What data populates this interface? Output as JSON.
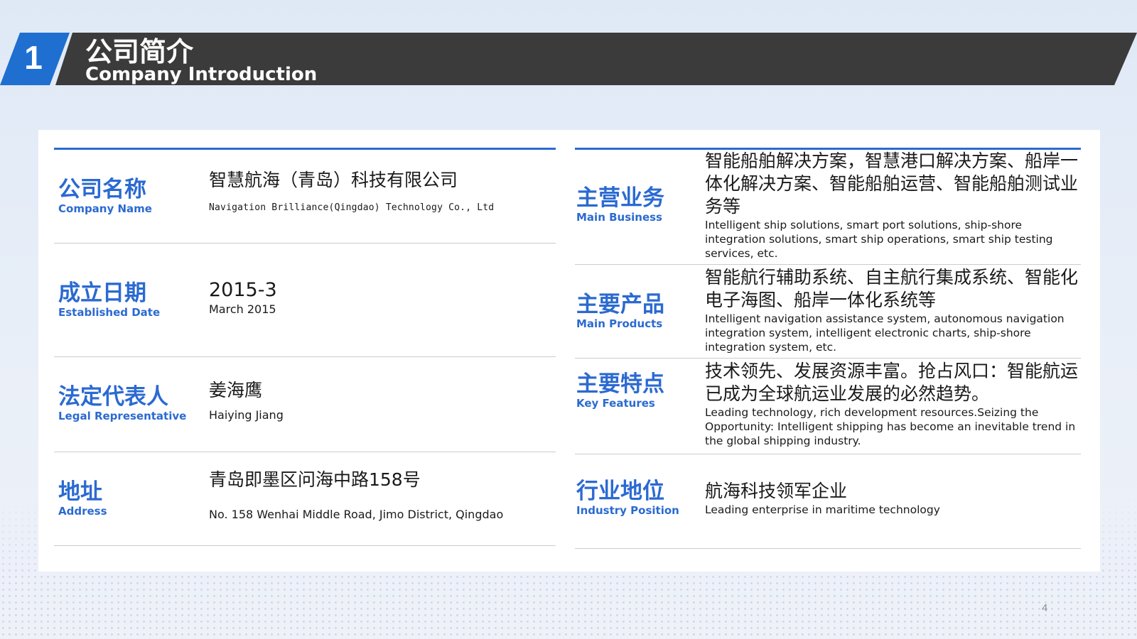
{
  "header": {
    "number": "1",
    "title_cn": "公司简介",
    "title_en": "Company Introduction"
  },
  "left_rows": [
    {
      "label_cn": "公司名称",
      "label_en": "Company Name",
      "value_cn": "智慧航海（青岛）科技有限公司",
      "value_en": "Navigation Brilliance(Qingdao) Technology Co., Ltd"
    },
    {
      "label_cn": "成立日期",
      "label_en": "Established Date",
      "value_cn": "2015-3",
      "value_en": "March 2015"
    },
    {
      "label_cn": "法定代表人",
      "label_en": "Legal Representative",
      "value_cn": "姜海鹰",
      "value_en": "Haiying Jiang"
    },
    {
      "label_cn": "地址",
      "label_en": "Address",
      "value_cn": "青岛即墨区问海中路158号",
      "value_en": "No. 158 Wenhai Middle Road, Jimo District, Qingdao"
    }
  ],
  "right_rows": [
    {
      "label_cn": "主营业务",
      "label_en": "Main Business",
      "value_cn": "智能船舶解决方案，智慧港口解决方案、船岸一体化解决方案、智能船舶运营、智能船舶测试业务等",
      "value_en": " Intelligent ship solutions, smart port solutions, ship-shore integration solutions, smart ship operations, smart ship testing services, etc."
    },
    {
      "label_cn": "主要产品",
      "label_en": "Main Products",
      "value_cn": "智能航行辅助系统、自主航行集成系统、智能化电子海图、船岸一体化系统等",
      "value_en": "Intelligent navigation assistance system, autonomous navigation integration system, intelligent electronic charts, ship-shore integration system, etc."
    },
    {
      "label_cn": "主要特点",
      "label_en": "Key Features",
      "value_cn": "技术领先、发展资源丰富。抢占风口：智能航运已成为全球航运业发展的必然趋势。",
      "value_en": "Leading technology, rich development resources.Seizing the Opportunity: Intelligent shipping has become an inevitable trend in the global shipping industry."
    },
    {
      "label_cn": "行业地位",
      "label_en": "Industry Position",
      "value_cn": "航海科技领军企业",
      "value_en": "Leading enterprise in maritime technology"
    }
  ],
  "page_number": "4",
  "colors": {
    "accent": "#2b6ad1",
    "title_bar": "#3b3b3b",
    "number_badge": "#1f6fd0"
  }
}
